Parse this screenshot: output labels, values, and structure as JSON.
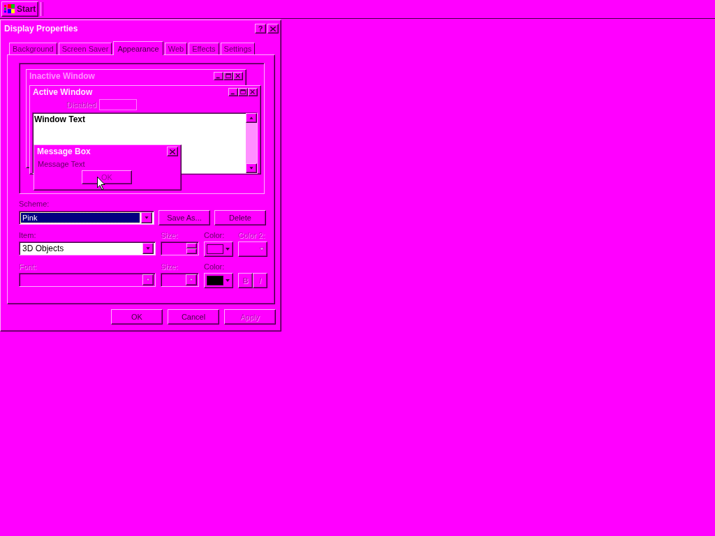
{
  "taskbar": {
    "start_button": {
      "label": "Start"
    }
  },
  "dialog": {
    "title": "Display Properties",
    "help_button": "?",
    "tabs": [
      {
        "label": "Background",
        "selected": false
      },
      {
        "label": "Screen Saver",
        "selected": false
      },
      {
        "label": "Appearance",
        "selected": true
      },
      {
        "label": "Web",
        "selected": false
      },
      {
        "label": "Effects",
        "selected": false
      },
      {
        "label": "Settings",
        "selected": false
      }
    ],
    "preview": {
      "inactive_window": {
        "title": "Inactive Window"
      },
      "active_window": {
        "title": "Active Window",
        "disabled_label": "Disabled",
        "window_text": "Window Text"
      },
      "message_box": {
        "title": "Message Box",
        "text": "Message Text",
        "button": "OK"
      }
    },
    "scheme": {
      "label": "Scheme:",
      "value": "Pink",
      "buttons": [
        {
          "label": "Save As...",
          "disabled": false
        },
        {
          "label": "Delete",
          "disabled": false
        }
      ]
    },
    "rows": [
      {
        "fields": [
          {
            "kind": "dropdown",
            "label": "Item:",
            "value": "3D Objects",
            "disabled": false
          },
          {
            "kind": "spinner",
            "label": "Size:",
            "disabled": true
          },
          {
            "kind": "color",
            "label": "Color:",
            "color": "#ff00ff",
            "disabled": false
          },
          {
            "kind": "color",
            "label": "Color 2:",
            "disabled": true
          }
        ]
      },
      {
        "fields": [
          {
            "kind": "dropdown",
            "label": "Font:",
            "disabled": true
          },
          {
            "kind": "small_dropdown",
            "label": "Size:",
            "disabled": true
          },
          {
            "kind": "color",
            "label": "Color:",
            "color": "#000000",
            "disabled": false
          },
          {
            "kind": "style_buttons",
            "buttons": [
              {
                "label": "B",
                "disabled": true
              },
              {
                "label": "I",
                "disabled": true
              }
            ]
          }
        ]
      }
    ],
    "buttons": [
      {
        "label": "OK",
        "disabled": false
      },
      {
        "label": "Cancel",
        "disabled": false
      },
      {
        "label": "Apply",
        "disabled": true
      }
    ]
  }
}
